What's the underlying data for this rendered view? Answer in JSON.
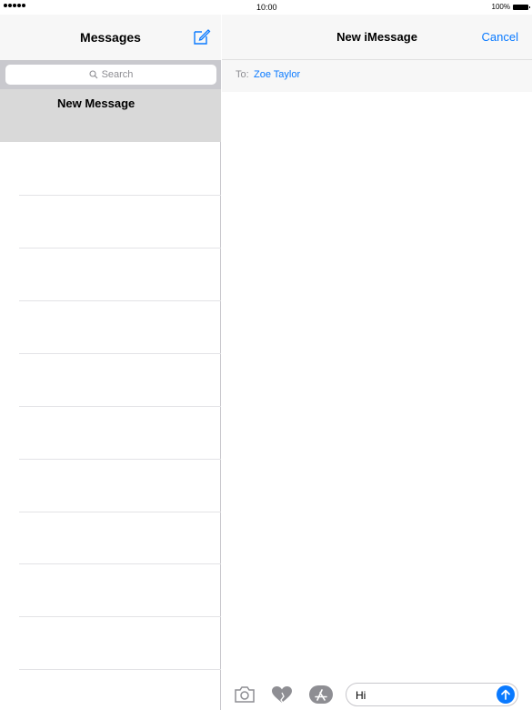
{
  "status_bar": {
    "signal_dots": 5,
    "time": "10:00",
    "battery_percent": "100%"
  },
  "left": {
    "title": "Messages",
    "compose_icon": "compose-icon",
    "search": {
      "placeholder": "Search",
      "icon": "magnifier-icon"
    },
    "conversations": [
      {
        "label": "New Message",
        "selected": true
      }
    ],
    "empty_rows": 10
  },
  "right": {
    "title": "New iMessage",
    "cancel_label": "Cancel",
    "to_label": "To:",
    "recipient": "Zoe Taylor",
    "input": {
      "value": "Hi",
      "icons": [
        "camera-icon",
        "digital-touch-heart-icon",
        "app-store-icon"
      ],
      "send_icon": "send-arrow-icon"
    }
  },
  "colors": {
    "accent": "#0a7aff",
    "selected_row": "#d9d9d9",
    "nav_bg": "#f7f7f7",
    "search_bg": "#c9c9ce"
  }
}
